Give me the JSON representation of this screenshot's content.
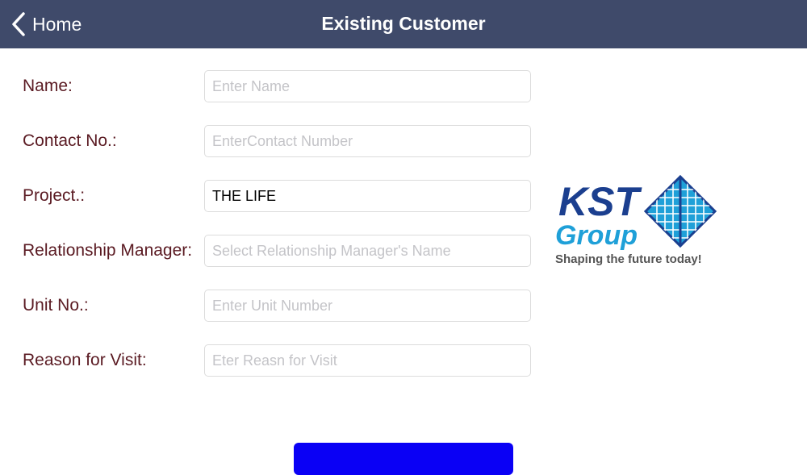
{
  "navbar": {
    "back_label": "Home",
    "title": "Existing Customer",
    "background": "#3f4a6a"
  },
  "form": {
    "fields": [
      {
        "label": "Name:",
        "value": "",
        "placeholder": "Enter Name"
      },
      {
        "label": "Contact No.:",
        "value": "",
        "placeholder": "EnterContact Number"
      },
      {
        "label": "Project.:",
        "value": "THE LIFE",
        "placeholder": ""
      },
      {
        "label": "Relationship Manager:",
        "value": "",
        "placeholder": "Select Relationship Manager's Name"
      },
      {
        "label": "Unit No.:",
        "value": "",
        "placeholder": "Enter Unit Number"
      },
      {
        "label": "Reason for Visit:",
        "value": "",
        "placeholder": "Eter Reasn for Visit"
      }
    ],
    "label_color": "#5a1a22"
  },
  "logo": {
    "brand_text_1": "KST",
    "brand_text_2": "Group",
    "tagline": "Shaping the future today!",
    "primary_color": "#1b3f8f",
    "secondary_color": "#1fa0d8"
  },
  "submit": {
    "color": "#0a00f5"
  }
}
